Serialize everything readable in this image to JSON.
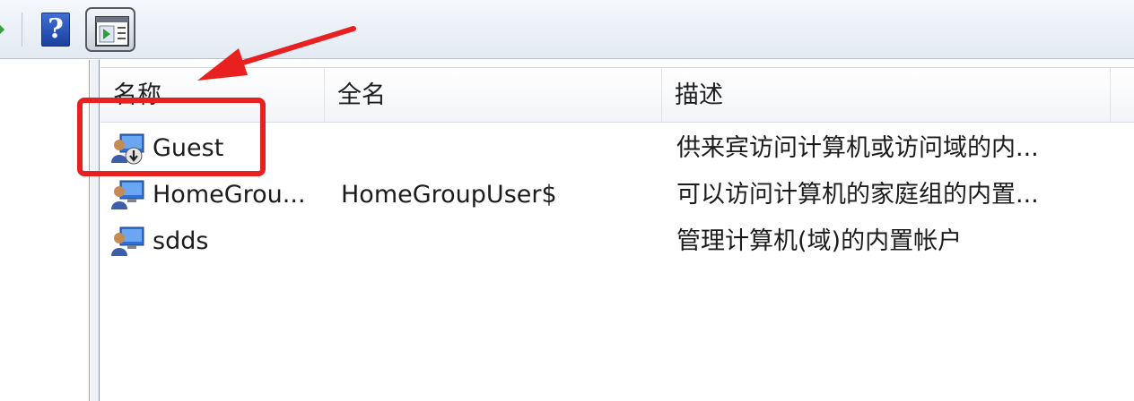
{
  "toolbar": {
    "help_label": "?",
    "icons": [
      "forward-arrow-icon",
      "help-icon",
      "show-hide-action-pane-icon"
    ]
  },
  "columns": [
    {
      "label": "名称"
    },
    {
      "label": "全名"
    },
    {
      "label": "描述"
    }
  ],
  "rows": [
    {
      "name": "Guest",
      "full_name": "",
      "description": "供来宾访问计算机或访问域的内...",
      "icon": "disabled-user-icon"
    },
    {
      "name": "HomeGrou...",
      "full_name": "HomeGroupUser$",
      "description": "可以访问计算机的家庭组的内置...",
      "icon": "user-icon"
    },
    {
      "name": "sdds",
      "full_name": "",
      "description": "管理计算机(域)的内置帐户",
      "icon": "user-icon"
    }
  ],
  "annotation": {
    "color": "#e8201f"
  }
}
